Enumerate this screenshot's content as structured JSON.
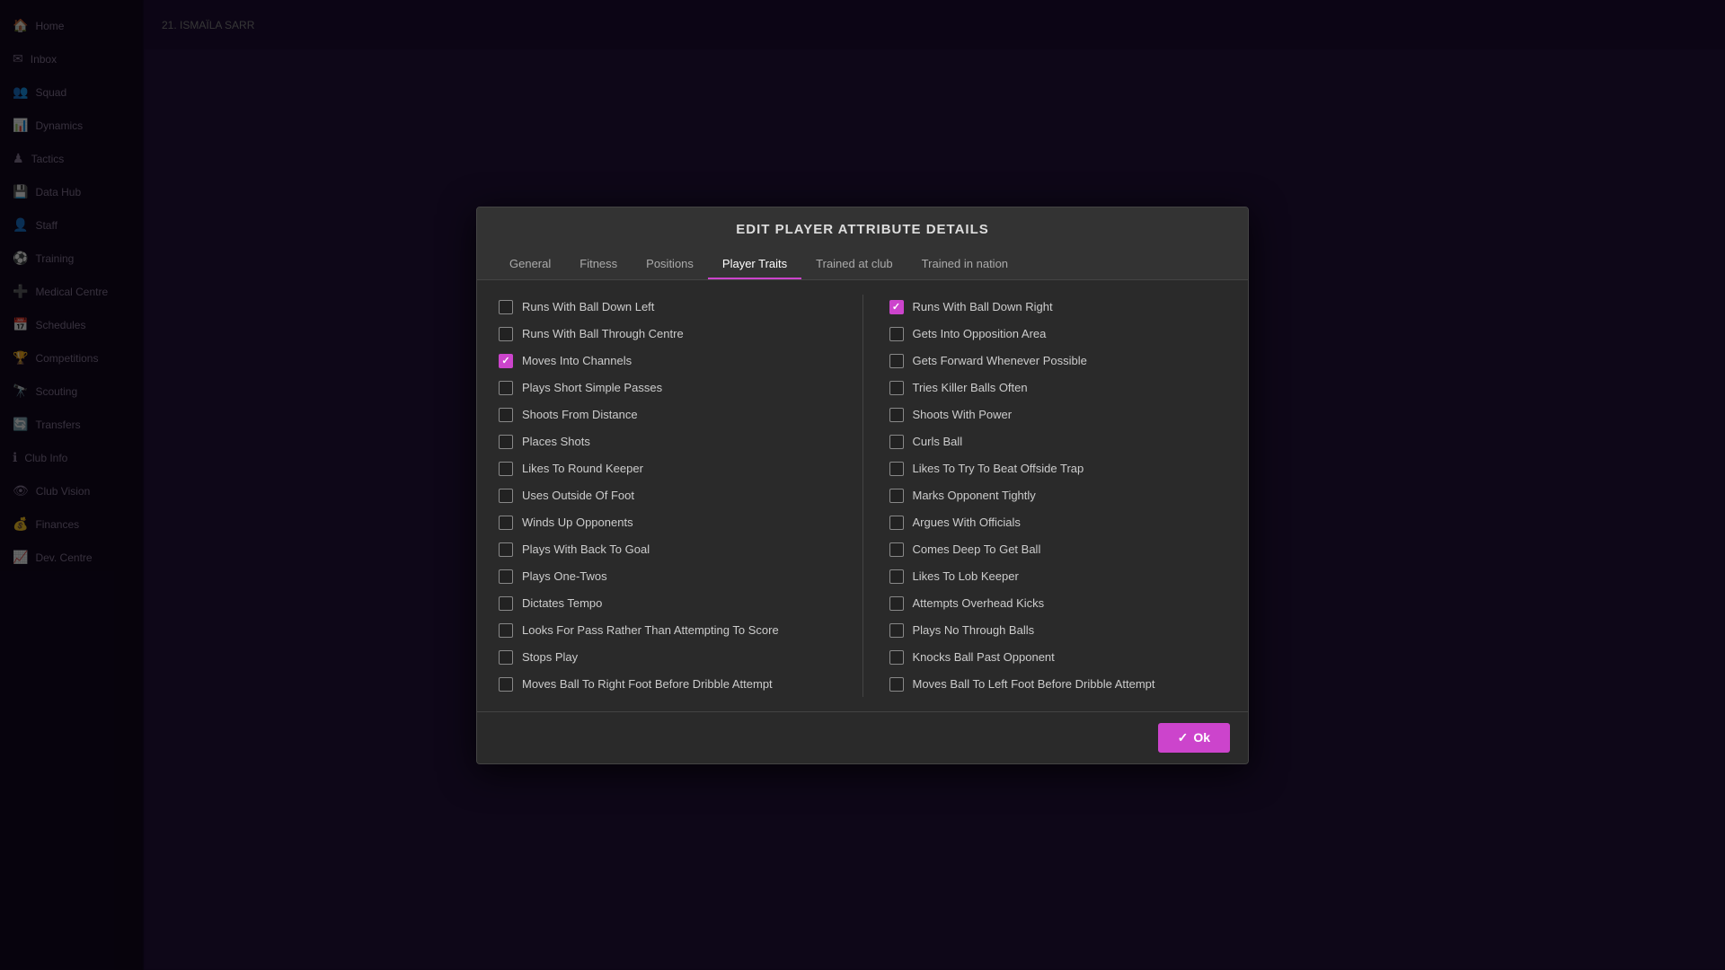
{
  "modal": {
    "title": "EDIT PLAYER ATTRIBUTE DETAILS",
    "tabs": [
      {
        "id": "general",
        "label": "General",
        "active": false
      },
      {
        "id": "fitness",
        "label": "Fitness",
        "active": false
      },
      {
        "id": "positions",
        "label": "Positions",
        "active": false
      },
      {
        "id": "player-traits",
        "label": "Player Traits",
        "active": true
      },
      {
        "id": "trained-at-club",
        "label": "Trained at club",
        "active": false
      },
      {
        "id": "trained-in-nation",
        "label": "Trained in nation",
        "active": false
      }
    ],
    "ok_button": "Ok",
    "left_traits": [
      {
        "label": "Runs With Ball Down Left",
        "checked": false
      },
      {
        "label": "Runs With Ball Through Centre",
        "checked": false
      },
      {
        "label": "Moves Into Channels",
        "checked": true
      },
      {
        "label": "Plays Short Simple Passes",
        "checked": false
      },
      {
        "label": "Shoots From Distance",
        "checked": false
      },
      {
        "label": "Places Shots",
        "checked": false
      },
      {
        "label": "Likes To Round Keeper",
        "checked": false
      },
      {
        "label": "Uses Outside Of Foot",
        "checked": false
      },
      {
        "label": "Winds Up Opponents",
        "checked": false
      },
      {
        "label": "Plays With Back To Goal",
        "checked": false
      },
      {
        "label": "Plays One-Twos",
        "checked": false
      },
      {
        "label": "Dictates Tempo",
        "checked": false
      },
      {
        "label": "Looks For Pass Rather Than Attempting To Score",
        "checked": false
      },
      {
        "label": "Stops Play",
        "checked": false
      },
      {
        "label": "Moves Ball To Right Foot Before Dribble Attempt",
        "checked": false
      }
    ],
    "right_traits": [
      {
        "label": "Runs With Ball Down Right",
        "checked": true
      },
      {
        "label": "Gets Into Opposition Area",
        "checked": false
      },
      {
        "label": "Gets Forward Whenever Possible",
        "checked": false
      },
      {
        "label": "Tries Killer Balls Often",
        "checked": false
      },
      {
        "label": "Shoots With Power",
        "checked": false
      },
      {
        "label": "Curls Ball",
        "checked": false
      },
      {
        "label": "Likes To Try To Beat Offside Trap",
        "checked": false
      },
      {
        "label": "Marks Opponent Tightly",
        "checked": false
      },
      {
        "label": "Argues With Officials",
        "checked": false
      },
      {
        "label": "Comes Deep To Get Ball",
        "checked": false
      },
      {
        "label": "Likes To Lob Keeper",
        "checked": false
      },
      {
        "label": "Attempts Overhead Kicks",
        "checked": false
      },
      {
        "label": "Plays No Through Balls",
        "checked": false
      },
      {
        "label": "Knocks Ball Past Opponent",
        "checked": false
      },
      {
        "label": "Moves Ball To Left Foot Before Dribble Attempt",
        "checked": false
      }
    ]
  },
  "sidebar": {
    "items": [
      {
        "label": "Home",
        "icon": "🏠"
      },
      {
        "label": "Inbox",
        "icon": "✉"
      },
      {
        "label": "Squad",
        "icon": "👥"
      },
      {
        "label": "Dynamics",
        "icon": "📊"
      },
      {
        "label": "Tactics",
        "icon": "♟"
      },
      {
        "label": "Data Hub",
        "icon": "💾"
      },
      {
        "label": "Staff",
        "icon": "👤"
      },
      {
        "label": "Training",
        "icon": "⚽"
      },
      {
        "label": "Medical Centre",
        "icon": "➕"
      },
      {
        "label": "Schedules",
        "icon": "📅"
      },
      {
        "label": "Competitions",
        "icon": "🏆"
      },
      {
        "label": "Scouting",
        "icon": "🔭"
      },
      {
        "label": "Transfers",
        "icon": "🔄"
      },
      {
        "label": "Club Info",
        "icon": "ℹ"
      },
      {
        "label": "Club Vision",
        "icon": "👁"
      },
      {
        "label": "Finances",
        "icon": "💰"
      },
      {
        "label": "Dev. Centre",
        "icon": "📈"
      }
    ]
  }
}
